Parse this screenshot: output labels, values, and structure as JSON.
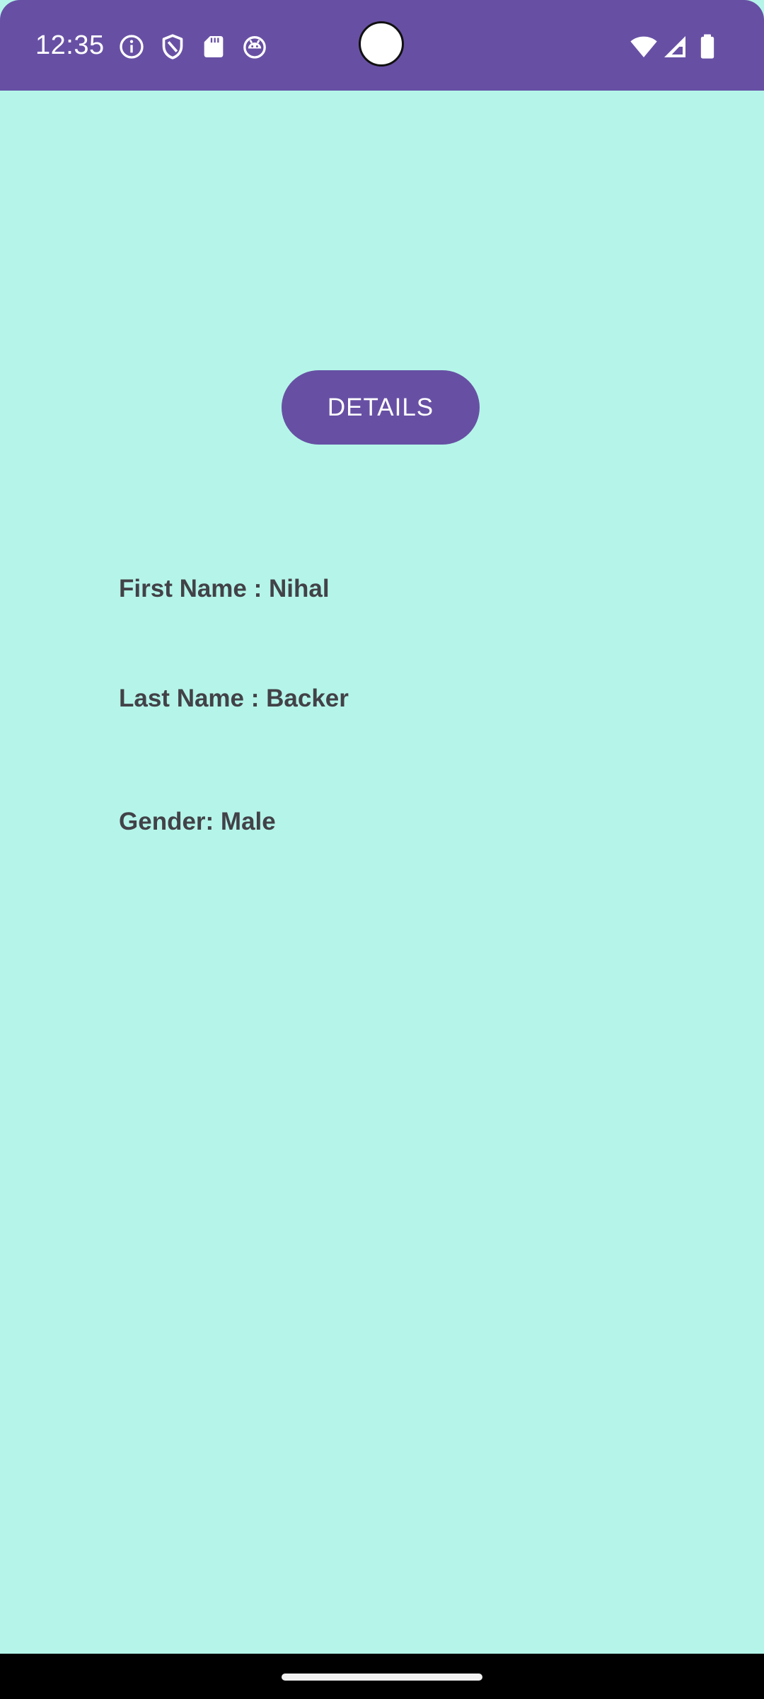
{
  "status_bar": {
    "time": "12:35",
    "left_icons": [
      "info-icon",
      "shield-icon",
      "sd-card-icon",
      "android-icon"
    ],
    "right_icons": [
      "wifi-icon",
      "signal-icon",
      "battery-icon"
    ],
    "color": "#6750a4"
  },
  "main": {
    "background": "#b5f5e9",
    "details_button_label": "DETAILS",
    "first_name_line": "First Name : Nihal",
    "last_name_line": "Last Name : Backer",
    "gender_line": "Gender: Male"
  }
}
